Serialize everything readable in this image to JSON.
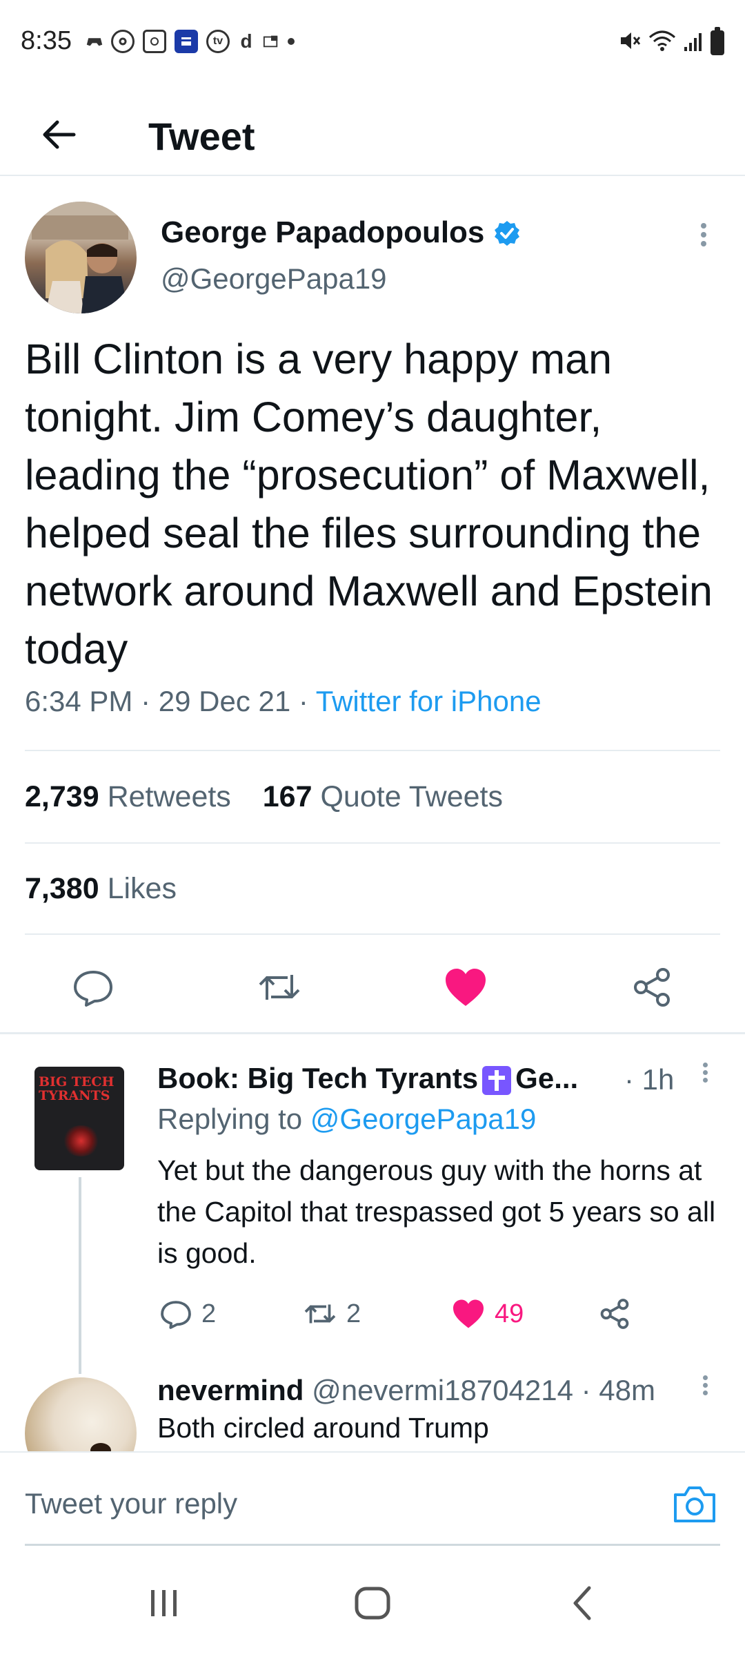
{
  "status_bar": {
    "time": "8:35",
    "left_icons": [
      "game-controller-icon",
      "at-symbol-icon",
      "disney-icon",
      "news-icon",
      "tv-icon",
      "d-icon",
      "tablet-icon",
      "dot-icon"
    ],
    "left_icon_text": {
      "tv": "tv",
      "d": "d"
    },
    "right_icons": [
      "mute-icon",
      "wifi-icon",
      "signal-icon",
      "battery-icon"
    ]
  },
  "header": {
    "title": "Tweet"
  },
  "tweet": {
    "author_name": "George Papadopoulos",
    "author_handle": "@GeorgePapa19",
    "verified": true,
    "text": "Bill Clinton is a very happy man tonight. Jim Comey’s daughter, leading the “prosecution” of Maxwell, helped seal the files surrounding the network around Maxwell and Epstein today",
    "timestamp": "6:34 PM · 29 Dec 21 · ",
    "source": "Twitter for iPhone",
    "retweets_count": "2,739",
    "retweets_label": "Retweets",
    "quote_count": "167",
    "quote_label": "Quote Tweets",
    "likes_count": "7,380",
    "likes_label": "Likes",
    "liked": true
  },
  "replies": [
    {
      "name": "Book: Big Tech Tyrants",
      "name_suffix": "Ge...",
      "time": "· 1h",
      "replying_prefix": "Replying to ",
      "replying_to": "@GeorgePapa19",
      "text": "Yet but the dangerous guy with the horns at the Capitol that trespassed got 5 years so all is good.",
      "reply_count": "2",
      "retweet_count": "2",
      "like_count": "49",
      "avatar_text": "BIG TECH TYRANTS"
    },
    {
      "name": "nevermind",
      "handle": "@nevermi18704214",
      "time": "· 48m",
      "text": "Both circled around Trump"
    }
  ],
  "compose": {
    "placeholder": "Tweet your reply"
  },
  "colors": {
    "accent": "#1d9bf0",
    "like": "#f91880",
    "text": "#0f1419",
    "muted": "#536471"
  }
}
